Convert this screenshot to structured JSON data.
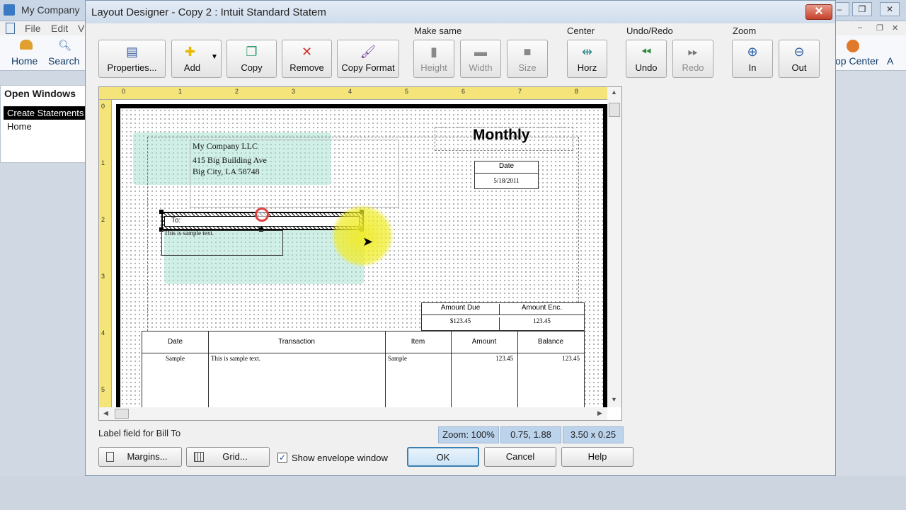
{
  "background_app": {
    "title": "My Company",
    "menu": {
      "file": "File",
      "edit": "Edit",
      "view": "V"
    },
    "toolbar": {
      "home": "Home",
      "search": "Search",
      "right_item": "op Center",
      "right_extra": "A"
    },
    "open_windows": {
      "heading": "Open Windows",
      "items": [
        "Create Statements",
        "Home"
      ]
    }
  },
  "dialog": {
    "title": "Layout Designer - Copy 2 : Intuit Standard Statem",
    "close_label": "✕",
    "toolbar": {
      "properties": "Properties...",
      "add": "Add",
      "copy": "Copy",
      "remove": "Remove",
      "copy_format": "Copy Format",
      "make_same_label": "Make same",
      "height": "Height",
      "width": "Width",
      "size": "Size",
      "center_label": "Center",
      "horz": "Horz",
      "undo_redo_label": "Undo/Redo",
      "undo": "Undo",
      "redo": "Redo",
      "zoom_label": "Zoom",
      "zoom_in": "In",
      "zoom_out": "Out"
    },
    "ruler": {
      "top_ticks": [
        "0",
        "1",
        "2",
        "3",
        "4",
        "5",
        "6",
        "7",
        "8"
      ],
      "left_ticks": [
        "0",
        "1",
        "2",
        "3",
        "4",
        "5"
      ]
    },
    "form": {
      "title_line1": "Monthly",
      "company_name": "My Company LLC",
      "address_line1": "415 Big Building Ave",
      "address_line2": "Big City, LA  58748",
      "date_header": "Date",
      "date_value": "5/18/2011",
      "to_label": "To:",
      "bill_to_sample": "This is sample text.",
      "amount_due_header": "Amount Due",
      "amount_enc_header": "Amount Enc.",
      "amount_due_value": "$123.45",
      "amount_enc_value": "123.45",
      "table_headers": [
        "Date",
        "Transaction",
        "Item",
        "Amount",
        "Balance"
      ],
      "table_row": [
        "Sample",
        "This is sample text.",
        "Sample",
        "123.45",
        "123.45"
      ]
    },
    "status": {
      "message": "Label field for Bill To",
      "zoom": "Zoom: 100%",
      "position": "0.75, 1.88",
      "dimensions": "3.50 x 0.25"
    },
    "buttons": {
      "margins": "Margins...",
      "grid": "Grid...",
      "show_envelope_label": "Show envelope window",
      "show_envelope_checked": true,
      "ok": "OK",
      "cancel": "Cancel",
      "help": "Help"
    }
  }
}
